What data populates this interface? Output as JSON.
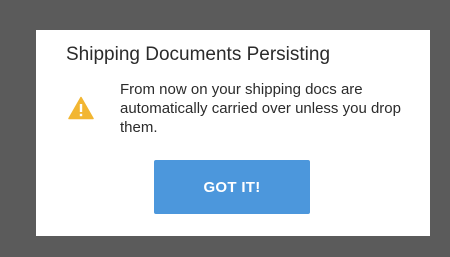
{
  "dialog": {
    "title": "Shipping Documents Persisting",
    "message": "From now on your shipping docs are automatically carried over unless you drop them.",
    "icon": "warning-icon",
    "button_label": "GOT IT!"
  },
  "colors": {
    "overlay": "#5b5b5b",
    "dialog_background": "#ffffff",
    "button": "#4c97dc",
    "warning": "#f2b632"
  }
}
